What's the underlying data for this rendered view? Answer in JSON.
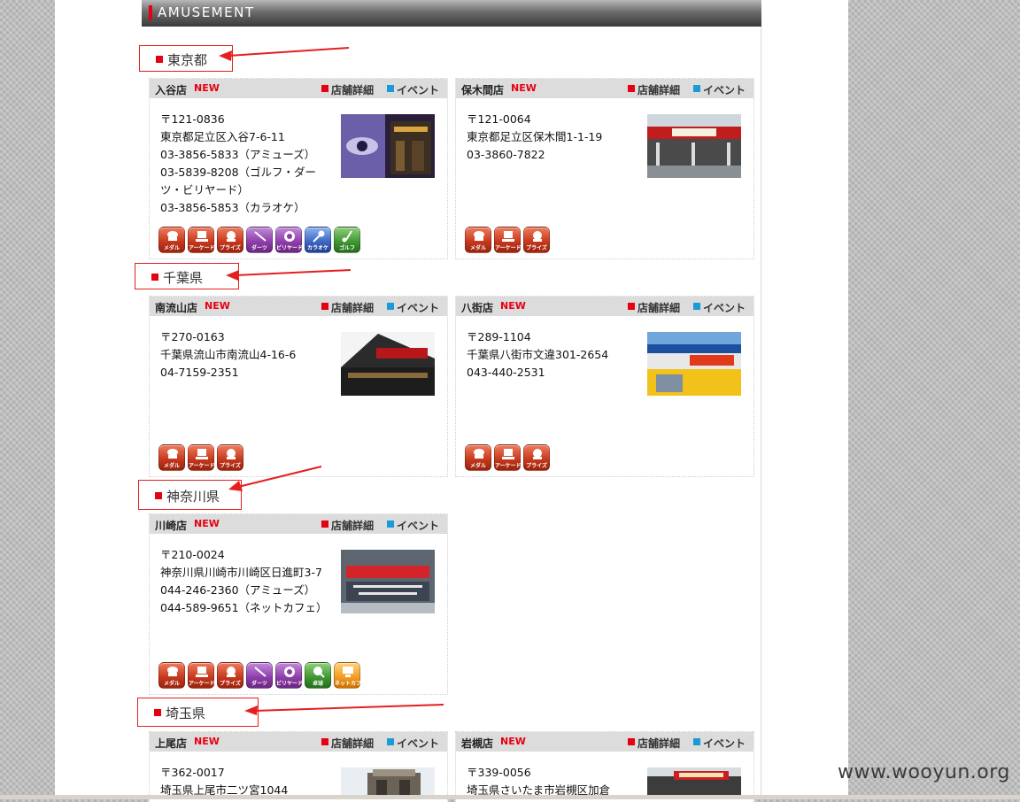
{
  "header": {
    "title": "AMUSEMENT"
  },
  "labels": {
    "new": "NEW",
    "detail": "店舗詳細",
    "event": "イベント"
  },
  "colors": {
    "accent_red": "#e60012",
    "event_blue": "#1a9ad6",
    "header_dark": "#3a3a3a"
  },
  "regions": [
    {
      "name": "東京都"
    },
    {
      "name": "千葉県"
    },
    {
      "name": "神奈川県"
    },
    {
      "name": "埼玉県"
    }
  ],
  "stores": [
    {
      "name": "入谷店",
      "lines": [
        "〒121-0836",
        "東京都足立区入谷7-6-11",
        "03-3856-5833（アミューズ）",
        "03-5839-8208（ゴルフ・ダーツ・ビリヤード）",
        "03-3856-5853（カラオケ）"
      ],
      "icons": [
        {
          "name": "medal-icon",
          "label": "メダル",
          "color": "red"
        },
        {
          "name": "arcade-icon",
          "label": "アーケード",
          "color": "red"
        },
        {
          "name": "prize-icon",
          "label": "プライズ",
          "color": "red"
        },
        {
          "name": "darts-icon",
          "label": "ダーツ",
          "color": "purple"
        },
        {
          "name": "billiards-icon",
          "label": "ビリヤード",
          "color": "purple"
        },
        {
          "name": "karaoke-icon",
          "label": "カラオケ",
          "color": "blue"
        },
        {
          "name": "golf-icon",
          "label": "ゴルフ",
          "color": "green"
        }
      ]
    },
    {
      "name": "保木間店",
      "lines": [
        "〒121-0064",
        "東京都足立区保木間1-1-19",
        "03-3860-7822"
      ],
      "icons": [
        {
          "name": "medal-icon",
          "label": "メダル",
          "color": "red"
        },
        {
          "name": "arcade-icon",
          "label": "アーケード",
          "color": "red"
        },
        {
          "name": "prize-icon",
          "label": "プライズ",
          "color": "red"
        }
      ]
    },
    {
      "name": "南流山店",
      "lines": [
        "〒270-0163",
        "千葉県流山市南流山4-16-6",
        "04-7159-2351"
      ],
      "icons": [
        {
          "name": "medal-icon",
          "label": "メダル",
          "color": "red"
        },
        {
          "name": "arcade-icon",
          "label": "アーケード",
          "color": "red"
        },
        {
          "name": "prize-icon",
          "label": "プライズ",
          "color": "red"
        }
      ]
    },
    {
      "name": "八街店",
      "lines": [
        "〒289-1104",
        "千葉県八街市文違301-2654",
        "043-440-2531"
      ],
      "icons": [
        {
          "name": "medal-icon",
          "label": "メダル",
          "color": "red"
        },
        {
          "name": "arcade-icon",
          "label": "アーケード",
          "color": "red"
        },
        {
          "name": "prize-icon",
          "label": "プライズ",
          "color": "red"
        }
      ]
    },
    {
      "name": "川崎店",
      "lines": [
        "〒210-0024",
        "神奈川県川崎市川崎区日進町3-7",
        "044-246-2360（アミューズ）",
        "044-589-9651（ネットカフェ）"
      ],
      "icons": [
        {
          "name": "medal-icon",
          "label": "メダル",
          "color": "red"
        },
        {
          "name": "arcade-icon",
          "label": "アーケード",
          "color": "red"
        },
        {
          "name": "prize-icon",
          "label": "プライズ",
          "color": "red"
        },
        {
          "name": "darts-icon",
          "label": "ダーツ",
          "color": "purple"
        },
        {
          "name": "billiards-icon",
          "label": "ビリヤード",
          "color": "purple"
        },
        {
          "name": "table-tennis-icon",
          "label": "卓球",
          "color": "green"
        },
        {
          "name": "net-cafe-icon",
          "label": "ネットカフェ",
          "color": "orange"
        }
      ]
    },
    {
      "name": "上尾店",
      "lines": [
        "〒362-0017",
        "埼玉県上尾市二ツ宮1044"
      ],
      "icons": []
    },
    {
      "name": "岩槻店",
      "lines": [
        "〒339-0056",
        "埼玉県さいたま市岩槻区加倉"
      ],
      "icons": []
    }
  ],
  "watermark": "www.wooyun.org"
}
